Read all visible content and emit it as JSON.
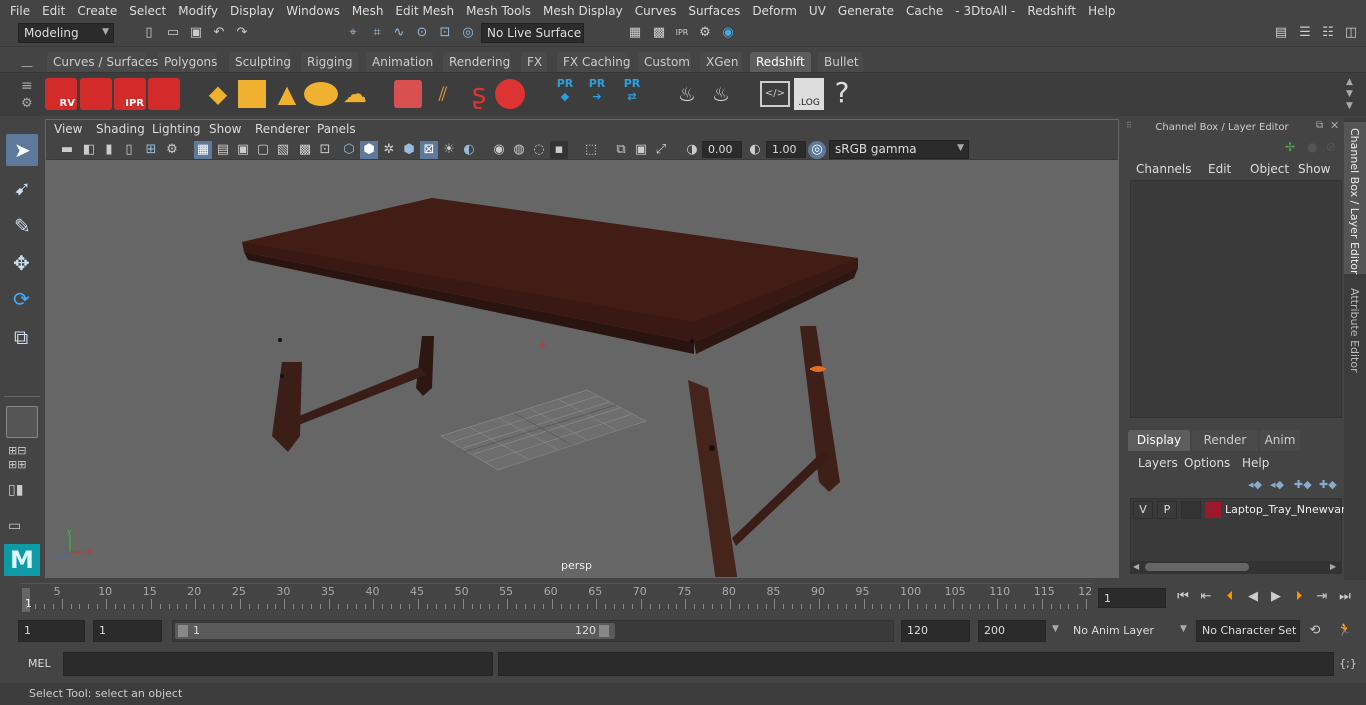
{
  "menubar": [
    "File",
    "Edit",
    "Create",
    "Select",
    "Modify",
    "Display",
    "Windows",
    "Mesh",
    "Edit Mesh",
    "Mesh Tools",
    "Mesh Display",
    "Curves",
    "Surfaces",
    "Deform",
    "UV",
    "Generate",
    "Cache",
    "- 3DtoAll -",
    "Redshift",
    "Help"
  ],
  "status": {
    "mode": "Modeling",
    "live_surface": "No Live Surface"
  },
  "shelf_tabs": [
    "Curves / Surfaces",
    "Polygons",
    "Sculpting",
    "Rigging",
    "Animation",
    "Rendering",
    "FX",
    "FX Caching",
    "Custom",
    "XGen",
    "Redshift",
    "Bullet"
  ],
  "shelf_active": "Redshift",
  "shelf_icons": {
    "rv": "RV",
    "ipr": "IPR",
    "pr": "PR",
    "log": ".LOG",
    "help": "?"
  },
  "viewport": {
    "menus": [
      "View",
      "Shading",
      "Lighting",
      "Show",
      "Renderer",
      "Panels"
    ],
    "exposure": "0.00",
    "gamma": "1.00",
    "colorspace": "sRGB gamma",
    "camera": "persp"
  },
  "channel_box": {
    "title": "Channel Box / Layer Editor",
    "menus": [
      "Channels",
      "Edit",
      "Object",
      "Show"
    ]
  },
  "layer_editor": {
    "tabs": [
      "Display",
      "Render",
      "Anim"
    ],
    "active_tab": "Display",
    "menus": [
      "Layers",
      "Options",
      "Help"
    ],
    "layer": {
      "v": "V",
      "p": "P",
      "name": "Laptop_Tray_Nnewvan",
      "color": "#9b1a2a"
    }
  },
  "side_tabs": [
    "Channel Box / Layer Editor",
    "Attribute Editor"
  ],
  "timeline": {
    "ticks": [
      "5",
      "10",
      "15",
      "20",
      "25",
      "30",
      "35",
      "40",
      "45",
      "50",
      "55",
      "60",
      "65",
      "70",
      "75",
      "80",
      "85",
      "90",
      "95",
      "100",
      "105",
      "110",
      "115",
      "12"
    ],
    "current_marker": "1",
    "current_frame": "1"
  },
  "range": {
    "start": "1",
    "playback_start": "1",
    "slider_start": "1",
    "slider_end": "120",
    "playback_end": "120",
    "end": "200",
    "anim_layer": "No Anim Layer",
    "char_set": "No Character Set"
  },
  "cmd": {
    "label": "MEL"
  },
  "help": "Select Tool: select an object"
}
